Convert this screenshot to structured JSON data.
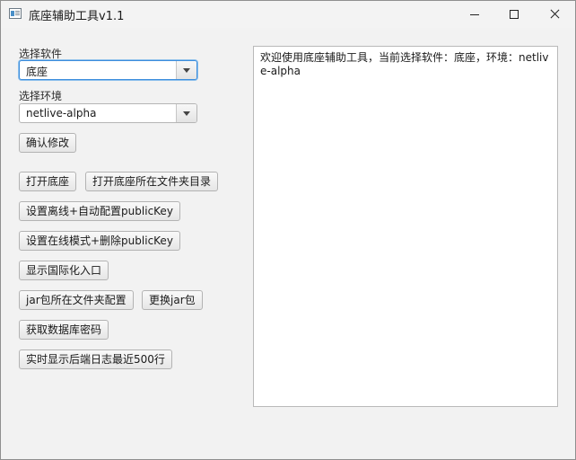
{
  "window": {
    "title": "底座辅助工具v1.1"
  },
  "software": {
    "label": "选择软件",
    "selected": "底座"
  },
  "environment": {
    "label": "选择环境",
    "selected": "netlive-alpha"
  },
  "buttons": {
    "confirm": "确认修改",
    "open_base": "打开底座",
    "open_base_folder": "打开底座所在文件夹目录",
    "offline_mode": "设置离线+自动配置publicKey",
    "online_mode": "设置在线模式+删除publicKey",
    "show_i18n": "显示国际化入口",
    "jar_folder_config": "jar包所在文件夹配置",
    "replace_jar": "更换jar包",
    "db_password": "获取数据库密码",
    "realtime_log": "实时显示后端日志最近500行"
  },
  "log": {
    "text": "欢迎使用底座辅助工具，当前选择软件：底座，环境：netlive-alpha"
  },
  "icons": {
    "app": "app-window-icon",
    "minimize": "minimize-icon",
    "maximize": "maximize-icon",
    "close": "close-icon",
    "dropdown": "chevron-down-icon"
  }
}
